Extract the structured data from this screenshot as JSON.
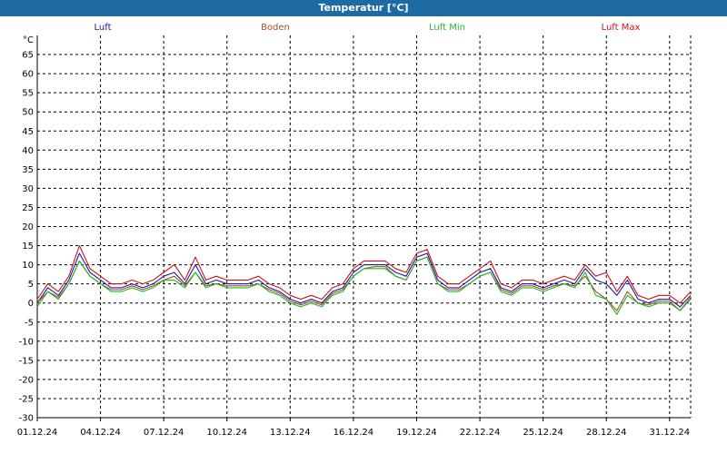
{
  "window": {
    "title": "Temperatur [°C]"
  },
  "chart_data": {
    "type": "line",
    "title": "Temperatur [°C]",
    "ylabel": "°C",
    "ylim": [
      -30,
      70
    ],
    "yticks": [
      65,
      60,
      55,
      50,
      45,
      40,
      35,
      30,
      25,
      20,
      15,
      10,
      5,
      0,
      -5,
      -10,
      -15,
      -20,
      -25,
      -30
    ],
    "x_tick_labels": [
      "01.12.24",
      "04.12.24",
      "07.12.24",
      "10.12.24",
      "13.12.24",
      "16.12.24",
      "19.12.24",
      "22.12.24",
      "25.12.24",
      "28.12.24",
      "31.12.24"
    ],
    "x_ticks": [
      1,
      4,
      7,
      10,
      13,
      16,
      19,
      22,
      25,
      28,
      31
    ],
    "xlim": [
      1,
      32
    ],
    "grid": true,
    "legend_position": "top",
    "x": [
      1,
      1.5,
      2,
      2.5,
      3,
      3.5,
      4,
      4.5,
      5,
      5.5,
      6,
      6.5,
      7,
      7.5,
      8,
      8.5,
      9,
      9.5,
      10,
      10.5,
      11,
      11.5,
      12,
      12.5,
      13,
      13.5,
      14,
      14.5,
      15,
      15.5,
      16,
      16.5,
      17,
      17.5,
      18,
      18.5,
      19,
      19.5,
      20,
      20.5,
      21,
      21.5,
      22,
      22.5,
      23,
      23.5,
      24,
      24.5,
      25,
      25.5,
      26,
      26.5,
      27,
      27.5,
      28,
      28.5,
      29,
      29.5,
      30,
      30.5,
      31,
      31.5,
      32
    ],
    "series": [
      {
        "name": "Luft",
        "color": "#1a1aa6",
        "values": [
          0,
          4,
          2,
          6,
          13,
          8,
          6,
          4,
          4,
          5,
          4,
          5,
          7,
          8,
          5,
          10,
          5,
          6,
          5,
          5,
          5,
          6,
          4,
          3,
          1,
          0,
          1,
          0,
          3,
          4,
          8,
          10,
          10,
          10,
          8,
          7,
          12,
          13,
          6,
          4,
          4,
          6,
          8,
          9,
          4,
          3,
          5,
          5,
          4,
          5,
          6,
          5,
          9,
          6,
          5,
          2,
          6,
          1,
          0,
          1,
          1,
          -1,
          2
        ]
      },
      {
        "name": "Boden",
        "color": "#a0522d",
        "values": [
          0,
          3,
          1.5,
          5,
          11,
          7,
          5,
          3.5,
          3.5,
          4.5,
          3.5,
          4.5,
          6,
          7,
          4.5,
          8,
          4.5,
          5,
          4.5,
          4.5,
          4.5,
          5,
          3.5,
          2.5,
          0.5,
          -0.5,
          0.5,
          -0.5,
          2.5,
          3.5,
          7,
          9,
          9.5,
          9.5,
          7,
          6,
          11,
          12,
          5,
          3.5,
          3.5,
          5,
          7,
          8,
          3.5,
          2.5,
          4.5,
          4.5,
          3.5,
          4.5,
          5,
          4.5,
          7,
          3,
          1,
          -2,
          3,
          0,
          -0.5,
          0.5,
          0.5,
          -2,
          1.5
        ]
      },
      {
        "name": "Luft Min",
        "color": "#22b822",
        "values": [
          -1,
          3,
          1,
          5,
          11,
          7,
          5,
          3,
          3,
          4,
          3,
          4,
          6,
          6,
          4,
          8,
          4,
          5,
          4,
          4,
          4,
          5,
          3,
          2,
          0,
          -1,
          0,
          -1,
          2,
          3,
          7,
          9,
          9,
          9,
          7,
          6,
          11,
          12,
          5,
          3,
          3,
          5,
          7,
          8,
          3,
          2,
          4,
          4,
          3,
          4,
          5,
          4,
          8,
          2,
          1,
          -3,
          2,
          0,
          -1,
          0,
          0,
          -2,
          1
        ]
      },
      {
        "name": "Luft Max",
        "color": "#d0101a",
        "values": [
          1,
          5,
          3,
          7,
          15,
          9,
          7,
          5,
          5,
          6,
          5,
          6,
          8,
          10,
          6,
          12,
          6,
          7,
          6,
          6,
          6,
          7,
          5,
          4,
          2,
          1,
          2,
          1,
          4,
          5,
          9,
          11,
          11,
          11,
          9,
          8,
          13,
          14,
          7,
          5,
          5,
          7,
          9,
          11,
          5,
          4,
          6,
          6,
          5,
          6,
          7,
          6,
          10,
          7,
          8,
          3,
          7,
          2,
          1,
          2,
          2,
          0,
          3
        ]
      }
    ]
  }
}
